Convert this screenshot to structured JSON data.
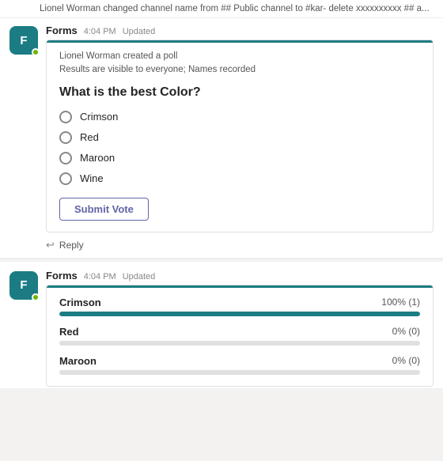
{
  "topbar": {
    "text": "Lionel Worman changed channel name from ## Public channel to #kar- delete xxxxxxxxxx ## a..."
  },
  "message1": {
    "sender": "Forms",
    "time": "4:04 PM",
    "badge": "Updated",
    "avatar_letter": "F",
    "creator_line1": "Lionel Worman created a poll",
    "creator_line2": "Results are visible to everyone; Names recorded",
    "question": "What is the best Color?",
    "options": [
      {
        "label": "Crimson"
      },
      {
        "label": "Red"
      },
      {
        "label": "Maroon"
      },
      {
        "label": "Wine"
      }
    ],
    "submit_label": "Submit Vote",
    "reply_label": "Reply"
  },
  "message2": {
    "sender": "Forms",
    "time": "4:04 PM",
    "badge": "Updated",
    "avatar_letter": "F",
    "results": [
      {
        "name": "Crimson",
        "percent_text": "100% (1)",
        "fill": 100
      },
      {
        "name": "Red",
        "percent_text": "0% (0)",
        "fill": 0
      },
      {
        "name": "Maroon",
        "percent_text": "0% (0)",
        "fill": 0
      }
    ]
  }
}
